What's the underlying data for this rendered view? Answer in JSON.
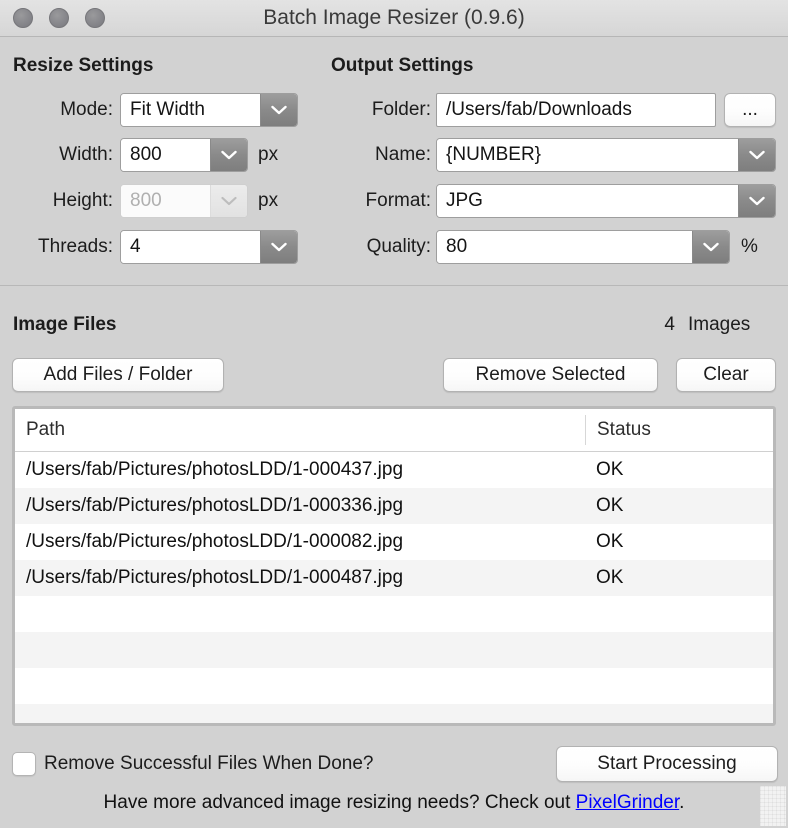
{
  "window": {
    "title": "Batch Image Resizer (0.9.6)",
    "traffic_lights": [
      "close-button",
      "minimize-button",
      "zoom-button"
    ]
  },
  "resize_settings": {
    "title": "Resize Settings",
    "mode": {
      "label": "Mode:",
      "value": "Fit Width"
    },
    "width": {
      "label": "Width:",
      "value": "800",
      "unit": "px"
    },
    "height": {
      "label": "Height:",
      "value": "800",
      "unit": "px",
      "disabled": true
    },
    "threads": {
      "label": "Threads:",
      "value": "4"
    }
  },
  "output_settings": {
    "title": "Output Settings",
    "folder": {
      "label": "Folder:",
      "value": "/Users/fab/Downloads",
      "browse_label": "..."
    },
    "name": {
      "label": "Name:",
      "value": "{NUMBER}"
    },
    "format": {
      "label": "Format:",
      "value": "JPG"
    },
    "quality": {
      "label": "Quality:",
      "value": "80",
      "unit": "%"
    }
  },
  "image_files": {
    "title": "Image Files",
    "count": "4",
    "count_word": "Images",
    "buttons": {
      "add": "Add Files / Folder",
      "remove_selected": "Remove Selected",
      "clear": "Clear"
    },
    "columns": [
      "Path",
      "Status"
    ],
    "rows": [
      {
        "path": "/Users/fab/Pictures/photosLDD/1-000437.jpg",
        "status": "OK"
      },
      {
        "path": "/Users/fab/Pictures/photosLDD/1-000336.jpg",
        "status": "OK"
      },
      {
        "path": "/Users/fab/Pictures/photosLDD/1-000082.jpg",
        "status": "OK"
      },
      {
        "path": "/Users/fab/Pictures/photosLDD/1-000487.jpg",
        "status": "OK"
      }
    ],
    "empty_row_count": 4
  },
  "footer": {
    "remove_successful_label": "Remove Successful Files When Done?",
    "remove_successful_checked": false,
    "start_button": "Start Processing",
    "promo_prefix": "Have more advanced image resizing needs? Check out ",
    "promo_link": "PixelGrinder",
    "promo_suffix": "."
  },
  "colors": {
    "window_background": "#d2d2d2",
    "titlebar": "#dcdcdc",
    "link": "#0000ff",
    "row_alt": "#f4f4f4",
    "dropdown_button": "#8a8a8a"
  }
}
